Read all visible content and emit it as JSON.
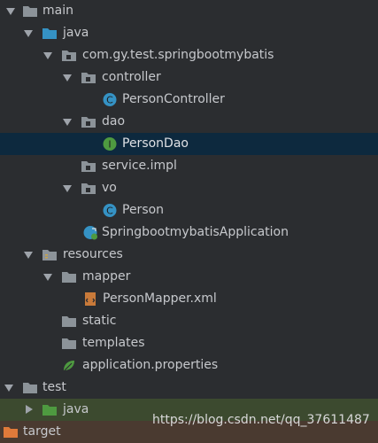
{
  "tree": {
    "main": "main",
    "java": "java",
    "package": "com.gy.test.springbootmybatis",
    "controller": "controller",
    "person_controller": "PersonController",
    "dao": "dao",
    "person_dao": "PersonDao",
    "service_impl": "service.impl",
    "vo": "vo",
    "person": "Person",
    "application": "SpringbootmybatisApplication",
    "resources": "resources",
    "mapper": "mapper",
    "person_mapper_xml": "PersonMapper.xml",
    "static": "static",
    "templates": "templates",
    "application_properties": "application.properties",
    "test": "test",
    "test_java": "java",
    "target": "target"
  },
  "class_icon_letter": "C",
  "interface_icon_letter": "I",
  "watermark": "https://blog.csdn.net/qq_37611487",
  "colors": {
    "background": "#2b2d30",
    "selected_row": "#0d293e",
    "test_java_row": "#3c4a2f",
    "target_row": "#4a3a30",
    "folder": "#8c9399",
    "source_folder": "#3592c4",
    "test_folder": "#4e9a40",
    "class_icon": "#3592c4",
    "interface_icon": "#4e9a40",
    "target_folder": "#e07a3a"
  }
}
